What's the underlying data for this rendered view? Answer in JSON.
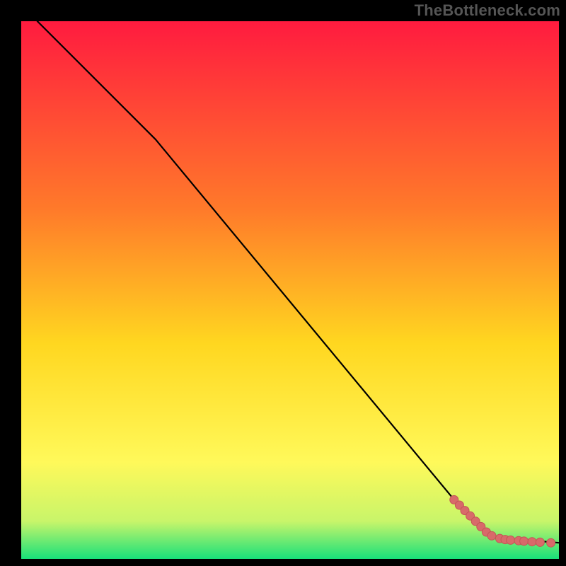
{
  "watermark": "TheBottleneck.com",
  "colors": {
    "gradient_top": "#ff1b3f",
    "gradient_mid1": "#ff7a2a",
    "gradient_mid2": "#ffd720",
    "gradient_mid3": "#fff95a",
    "gradient_mid4": "#c8f56a",
    "gradient_bottom": "#18e07a",
    "line": "#000000",
    "marker": "#d86a6a",
    "marker_stroke": "#c45555",
    "background": "#000000"
  },
  "chart_data": {
    "type": "line",
    "title": "",
    "xlabel": "",
    "ylabel": "",
    "xlim": [
      0,
      100
    ],
    "ylim": [
      0,
      100
    ],
    "grid": false,
    "line_points": [
      {
        "x": 3,
        "y": 100
      },
      {
        "x": 25,
        "y": 78
      },
      {
        "x": 83,
        "y": 8
      },
      {
        "x": 88,
        "y": 4
      },
      {
        "x": 100,
        "y": 3
      }
    ],
    "markers": [
      {
        "x": 80.5,
        "y": 11.0
      },
      {
        "x": 81.5,
        "y": 10.0
      },
      {
        "x": 82.5,
        "y": 9.0
      },
      {
        "x": 83.5,
        "y": 8.0
      },
      {
        "x": 84.5,
        "y": 7.0
      },
      {
        "x": 85.5,
        "y": 6.0
      },
      {
        "x": 86.5,
        "y": 5.0
      },
      {
        "x": 87.5,
        "y": 4.3
      },
      {
        "x": 89.0,
        "y": 3.8
      },
      {
        "x": 90.0,
        "y": 3.6
      },
      {
        "x": 91.0,
        "y": 3.5
      },
      {
        "x": 92.5,
        "y": 3.4
      },
      {
        "x": 93.5,
        "y": 3.3
      },
      {
        "x": 95.0,
        "y": 3.2
      },
      {
        "x": 96.5,
        "y": 3.1
      },
      {
        "x": 98.5,
        "y": 3.0
      }
    ],
    "marker_radius_px": 6
  }
}
